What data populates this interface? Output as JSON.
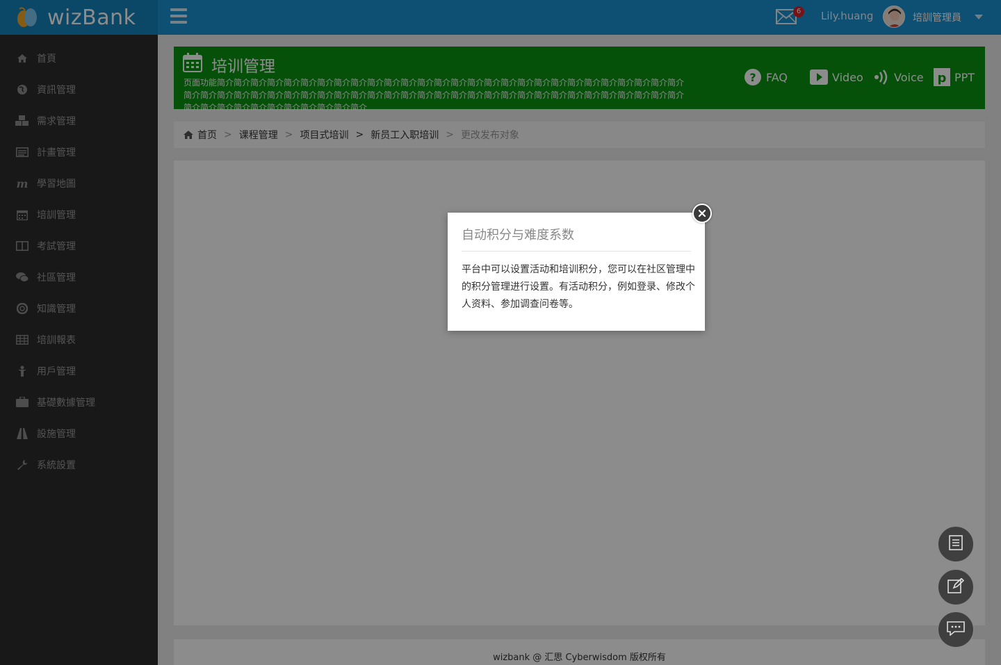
{
  "brand": {
    "name": "wizBank"
  },
  "topbar": {
    "mail_count": "6",
    "username": "Lily.huang",
    "role": "培訓管理員"
  },
  "sidebar": {
    "items": [
      {
        "label": "首頁",
        "icon": "home-icon"
      },
      {
        "label": "資訊管理",
        "icon": "globe-icon"
      },
      {
        "label": "需求管理",
        "icon": "cubes-icon"
      },
      {
        "label": "計畫管理",
        "icon": "list-card-icon"
      },
      {
        "label": "學習地圖",
        "icon": "map-m-icon"
      },
      {
        "label": "培訓管理",
        "icon": "calendar-icon"
      },
      {
        "label": "考試管理",
        "icon": "book-icon"
      },
      {
        "label": "社區管理",
        "icon": "comments-icon"
      },
      {
        "label": "知識管理",
        "icon": "lifebuoy-icon"
      },
      {
        "label": "培訓報表",
        "icon": "table-icon"
      },
      {
        "label": "用戶管理",
        "icon": "user-icon"
      },
      {
        "label": "基礎數據管理",
        "icon": "briefcase-icon"
      },
      {
        "label": "設施管理",
        "icon": "road-icon"
      },
      {
        "label": "系統設置",
        "icon": "wrench-icon"
      }
    ]
  },
  "header": {
    "title": "培训管理",
    "description": "页面功能简介简介简介简介简介简介简介简介简介简介简介简介简介简介简介简介简介简介简介简介简介简介简介简介简介简介简介简介简介简介简介简介简介简介简介简介简介简介简介简介简介简介简介简介简介简介简介简介简介简介简介简介简介简介简介简介简介简介简介简介简介简介简介简介简介简介简介简介简介",
    "help_links": {
      "faq": "FAQ",
      "video": "Video",
      "voice": "Voice",
      "ppt": "PPT"
    }
  },
  "breadcrumb": {
    "items": [
      "首页",
      "课程管理",
      "项目式培训",
      "新员工入职培训",
      "更改发布对象"
    ]
  },
  "footer": {
    "text": "wizbank @ 汇思 Cyberwisdom 版权所有"
  },
  "modal": {
    "title": "自动积分与难度系数",
    "body": "平台中可以设置活动和培训积分，您可以在社区管理中的积分管理进行设置。有活动积分，例如登录、修改个人资料、参加调查问卷等。"
  },
  "colors": {
    "topbar": "#1a93d3",
    "logo_bg": "#1581bb",
    "sidebar": "#2c2c2c",
    "header_card": "#0c9411",
    "badge": "#d9232a"
  }
}
